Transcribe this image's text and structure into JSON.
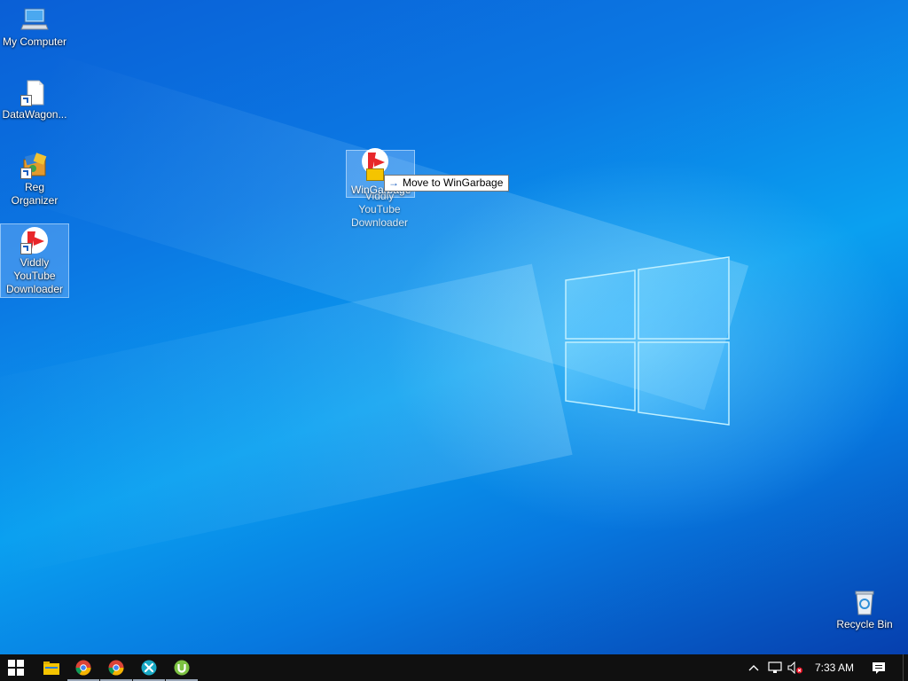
{
  "desktop_icons": {
    "my_computer": "My Computer",
    "datawagon": "DataWagon...",
    "reg_organizer": "Reg Organizer",
    "viddly": "Viddly YouTube Downloader",
    "recycle_bin": "Recycle Bin"
  },
  "drag": {
    "ghost_label": "Viddly YouTube Downloader",
    "target_label": "WinGarbage",
    "tooltip_arrow": "→",
    "tooltip_text": "Move to WinGarbage"
  },
  "taskbar": {
    "clock": "7:33 AM",
    "pinned": [
      "start",
      "file-explorer",
      "chrome",
      "chrome-alt",
      "app-x",
      "utorrent"
    ]
  },
  "colors": {
    "taskbar_bg": "#101010",
    "accent": "#0078d7"
  }
}
